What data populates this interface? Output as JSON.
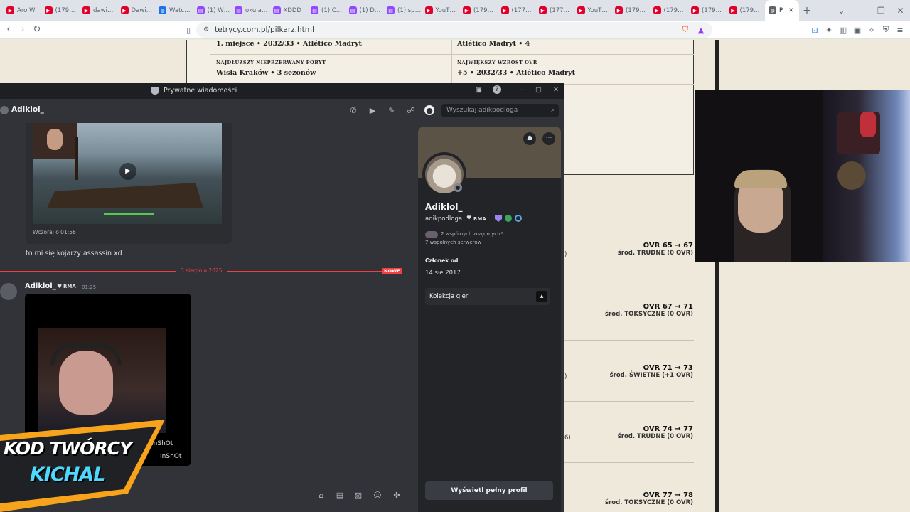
{
  "browser": {
    "tabs": [
      {
        "label": "Aro W",
        "icon": "youtube-icon",
        "color": "#e0002a"
      },
      {
        "label": "(179…",
        "icon": "youtube-icon",
        "color": "#e0002a"
      },
      {
        "label": "dawi…",
        "icon": "youtube-icon",
        "color": "#e0002a"
      },
      {
        "label": "Dawi…",
        "icon": "youtube-icon",
        "color": "#e0002a"
      },
      {
        "label": "Watc…",
        "icon": "globe-icon",
        "color": "#1a73e8"
      },
      {
        "label": "(1) W…",
        "icon": "twitch-icon",
        "color": "#9146ff"
      },
      {
        "label": "okula…",
        "icon": "twitch-icon",
        "color": "#9146ff"
      },
      {
        "label": "XDDD",
        "icon": "twitch-icon",
        "color": "#9146ff"
      },
      {
        "label": "(1) C…",
        "icon": "twitch-icon",
        "color": "#9146ff"
      },
      {
        "label": "(1) D…",
        "icon": "twitch-icon",
        "color": "#9146ff"
      },
      {
        "label": "(1) sp…",
        "icon": "twitch-icon",
        "color": "#9146ff"
      },
      {
        "label": "YouT…",
        "icon": "youtube-icon",
        "color": "#e0002a"
      },
      {
        "label": "(179…",
        "icon": "youtube-icon",
        "color": "#e0002a"
      },
      {
        "label": "(177…",
        "icon": "youtube-icon",
        "color": "#e0002a"
      },
      {
        "label": "(177…",
        "icon": "youtube-icon",
        "color": "#e0002a"
      },
      {
        "label": "YouT…",
        "icon": "youtube-icon",
        "color": "#e0002a"
      },
      {
        "label": "(179…",
        "icon": "youtube-icon",
        "color": "#e0002a"
      },
      {
        "label": "(179…",
        "icon": "youtube-icon",
        "color": "#e0002a"
      },
      {
        "label": "(179…",
        "icon": "youtube-icon",
        "color": "#e0002a"
      },
      {
        "label": "(179…",
        "icon": "youtube-icon",
        "color": "#e0002a"
      }
    ],
    "active_tab": {
      "label": "P"
    },
    "url": "tetrycy.com.pl/pilkarz.html"
  },
  "webpage": {
    "stats": [
      {
        "value": "1. miejsce • 2032/33 • Atlético Madryt"
      },
      {
        "value": "Atlético Madryt • 4"
      },
      {
        "caption": "NAJDŁUŻSZY NIEPRZERWANY POBYT",
        "value": "Wisła Kraków • 3 sezonów"
      },
      {
        "caption": "NAJWIĘKSZY WZROST OVR",
        "value": "+5 • 2032/33 • Atlético Madryt"
      }
    ],
    "seasons": [
      {
        "ovr": "OVR 65 → 67",
        "env": "środ. TRUDNE (0 OVR)",
        "stub": ")"
      },
      {
        "ovr": "OVR 67 → 71",
        "env": "środ. TOKSYCZNE (0 OVR)",
        "stub": ""
      },
      {
        "ovr": "OVR 71 → 73",
        "env": "środ. ŚWIETNE (+1 OVR)",
        "stub": ")"
      },
      {
        "ovr": "OVR 74 → 77",
        "env": "środ. TRUDNE (0 OVR)",
        "stub": "6)"
      },
      {
        "ovr": "OVR 77 → 78",
        "env": "środ. TOKSYCZNE (0 OVR)",
        "stub": ""
      }
    ]
  },
  "discord": {
    "window_title": "Prywatne wiadomości",
    "dm_user": "Adiklol_",
    "search_placeholder": "Wyszukaj adikpodloga",
    "messages": {
      "video_timestamp": "Wczoraj o 01:56",
      "text_message": "to mi się kojarzy assassin xd",
      "date_divider": "3 sierpnia 2025",
      "new_badge": "NOWE",
      "author": "Adiklol_",
      "author_tag": "RMA",
      "time": "01:25",
      "watermark": "InShOt"
    },
    "profile": {
      "display_name": "Adiklol_",
      "username": "adikpodloga",
      "tag": "RMA",
      "mutual_friends": "2 wspólnych znajomych",
      "mutual_servers": "7 wspólnych serwerów",
      "member_since_label": "Członek od",
      "member_since": "14 sie 2017",
      "game_collection": "Kolekcja gier",
      "full_profile_button": "Wyświetl pełny profil"
    }
  },
  "overlay": {
    "line1": "KOD TWÓRCY",
    "line2": "KICHAL",
    "colors": {
      "orange": "#f7a31b",
      "cyan": "#4fd8ff",
      "white": "#ffffff"
    }
  }
}
